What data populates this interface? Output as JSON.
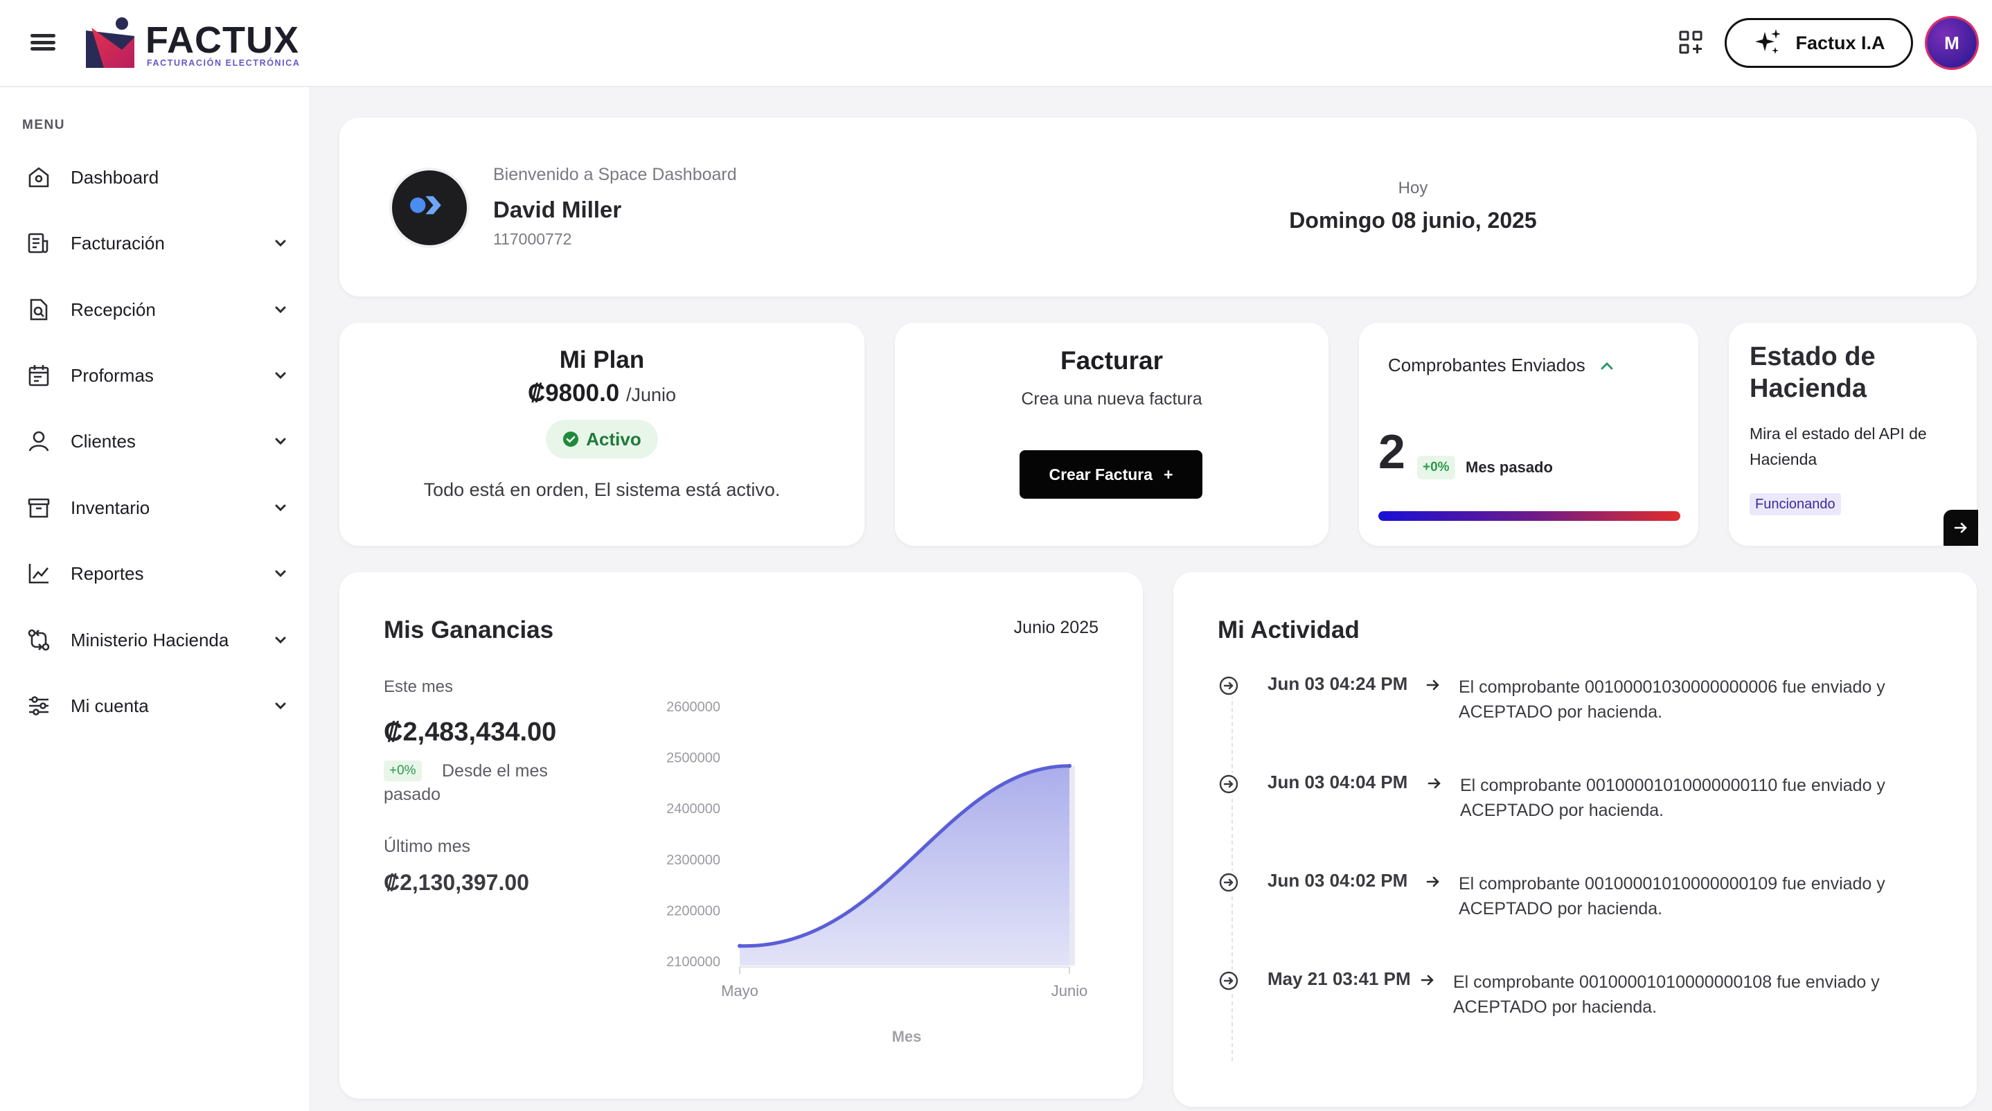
{
  "header": {
    "brand": "FACTUX",
    "brand_tagline": "FACTURACIÓN ELECTRÓNICA",
    "ai_button_label": "Factux I.A",
    "avatar_initial": "M"
  },
  "sidebar": {
    "heading": "MENU",
    "items": [
      {
        "label": "Dashboard",
        "icon": "home-icon"
      },
      {
        "label": "Facturación",
        "icon": "invoice-icon"
      },
      {
        "label": "Recepción",
        "icon": "document-search-icon"
      },
      {
        "label": "Proformas",
        "icon": "calendar-icon"
      },
      {
        "label": "Clientes",
        "icon": "user-icon"
      },
      {
        "label": "Inventario",
        "icon": "archive-box-icon"
      },
      {
        "label": "Reportes",
        "icon": "chart-line-icon"
      },
      {
        "label": "Ministerio Hacienda",
        "icon": "git-compare-icon"
      },
      {
        "label": "Mi cuenta",
        "icon": "sliders-icon"
      }
    ]
  },
  "welcome": {
    "subtitle": "Bienvenido a Space Dashboard",
    "name": "David Miller",
    "id_number": "117000772",
    "today_label": "Hoy",
    "today_date": "Domingo 08 junio, 2025"
  },
  "plan": {
    "title": "Mi Plan",
    "price": "₡9800.0",
    "period": "/Junio",
    "status": "Activo",
    "message": "Todo está en orden, El sistema está activo."
  },
  "facturar": {
    "title": "Facturar",
    "subtitle": "Crea una nueva factura",
    "button_label": "Crear Factura",
    "button_icon": "+"
  },
  "comprobantes": {
    "title": "Comprobantes Enviados",
    "value": "2",
    "change": "+0%",
    "change_label": "Mes pasado",
    "progress_fraction": 1.0,
    "bar_colors": [
      "#1a10d6",
      "#6a1a8c",
      "#e12c2c"
    ]
  },
  "estado": {
    "title": "Estado de Hacienda",
    "subtitle": "Mira el estado del API de Hacienda",
    "status": "Funcionando"
  },
  "ganancias": {
    "title": "Mis Ganancias",
    "period": "Junio 2025",
    "this_month_label": "Este mes",
    "this_month_value": "₡2,483,434.00",
    "change": "+0%",
    "change_label": "Desde el mes pasado",
    "last_month_label": "Último mes",
    "last_month_value": "₡2,130,397.00"
  },
  "chart_data": {
    "type": "area",
    "categories": [
      "Mayo",
      "Junio"
    ],
    "values": [
      2130397,
      2483434
    ],
    "xlabel": "Mes",
    "ylabel": "",
    "ylim": [
      2100000,
      2600000
    ],
    "yticks": [
      "2600000",
      "2500000",
      "2400000",
      "2300000",
      "2200000",
      "2100000"
    ],
    "line_color": "#5a5fd6",
    "fill_color": "#b9bbee",
    "grid": false
  },
  "actividad": {
    "title": "Mi Actividad",
    "items": [
      {
        "time": "Jun 03 04:24 PM",
        "text": "El comprobante 00100001030000000006 fue enviado y ACEPTADO por hacienda."
      },
      {
        "time": "Jun 03 04:04 PM",
        "text": "El comprobante 00100001010000000110 fue enviado y ACEPTADO por hacienda."
      },
      {
        "time": "Jun 03 04:02 PM",
        "text": "El comprobante 00100001010000000109 fue enviado y ACEPTADO por hacienda."
      },
      {
        "time": "May 21 03:41 PM",
        "text": "El comprobante 00100001010000000108 fue enviado y ACEPTADO por hacienda."
      }
    ]
  }
}
